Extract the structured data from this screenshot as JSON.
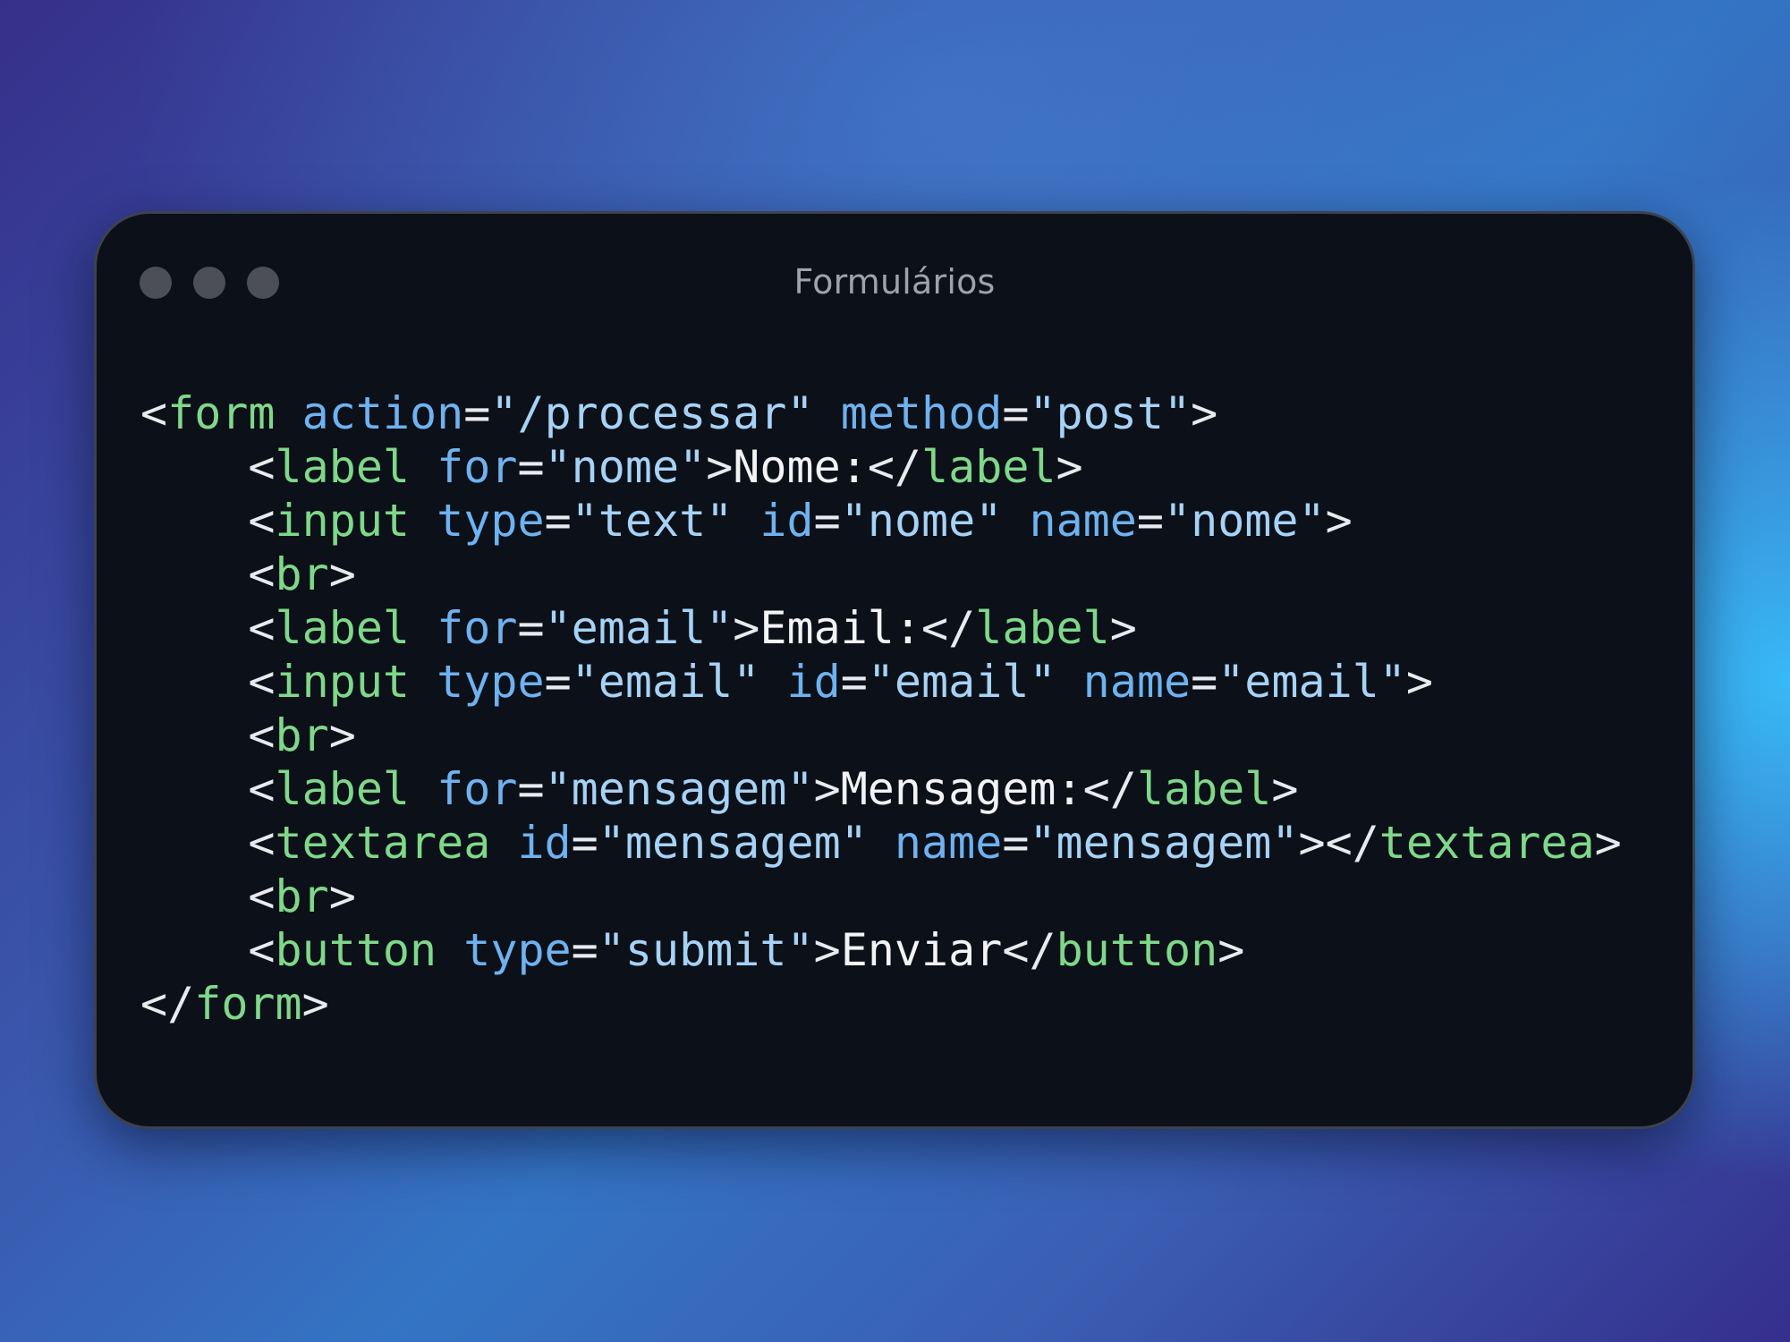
{
  "window": {
    "title": "Formulários",
    "controls": [
      "close",
      "minimize",
      "zoom"
    ]
  },
  "colors": {
    "background_start": "#36308a",
    "background_glow": "#38bef9",
    "window_bg": "#0c1018",
    "tag": "#7fd88a",
    "attribute": "#6eb2f0",
    "string": "#a6d2f5",
    "text": "#f2f3f5",
    "title": "#9da3ad",
    "control_dot": "#4c4f57"
  },
  "code": {
    "language": "html",
    "lines": [
      [
        [
          "punc",
          "<"
        ],
        [
          "tag",
          "form"
        ],
        [
          "punc",
          " "
        ],
        [
          "attr",
          "action"
        ],
        [
          "punc",
          "="
        ],
        [
          "str",
          "\"/processar\""
        ],
        [
          "punc",
          " "
        ],
        [
          "attr",
          "method"
        ],
        [
          "punc",
          "="
        ],
        [
          "str",
          "\"post\""
        ],
        [
          "punc",
          ">"
        ]
      ],
      [
        [
          "punc",
          "    <"
        ],
        [
          "tag",
          "label"
        ],
        [
          "punc",
          " "
        ],
        [
          "attr",
          "for"
        ],
        [
          "punc",
          "="
        ],
        [
          "str",
          "\"nome\""
        ],
        [
          "punc",
          ">"
        ],
        [
          "txt",
          "Nome:"
        ],
        [
          "punc",
          "</"
        ],
        [
          "tag",
          "label"
        ],
        [
          "punc",
          ">"
        ]
      ],
      [
        [
          "punc",
          "    <"
        ],
        [
          "tag",
          "input"
        ],
        [
          "punc",
          " "
        ],
        [
          "attr",
          "type"
        ],
        [
          "punc",
          "="
        ],
        [
          "str",
          "\"text\""
        ],
        [
          "punc",
          " "
        ],
        [
          "attr",
          "id"
        ],
        [
          "punc",
          "="
        ],
        [
          "str",
          "\"nome\""
        ],
        [
          "punc",
          " "
        ],
        [
          "attr",
          "name"
        ],
        [
          "punc",
          "="
        ],
        [
          "str",
          "\"nome\""
        ],
        [
          "punc",
          ">"
        ]
      ],
      [
        [
          "punc",
          "    <"
        ],
        [
          "tag",
          "br"
        ],
        [
          "punc",
          ">"
        ]
      ],
      [
        [
          "punc",
          "    <"
        ],
        [
          "tag",
          "label"
        ],
        [
          "punc",
          " "
        ],
        [
          "attr",
          "for"
        ],
        [
          "punc",
          "="
        ],
        [
          "str",
          "\"email\""
        ],
        [
          "punc",
          ">"
        ],
        [
          "txt",
          "Email:"
        ],
        [
          "punc",
          "</"
        ],
        [
          "tag",
          "label"
        ],
        [
          "punc",
          ">"
        ]
      ],
      [
        [
          "punc",
          "    <"
        ],
        [
          "tag",
          "input"
        ],
        [
          "punc",
          " "
        ],
        [
          "attr",
          "type"
        ],
        [
          "punc",
          "="
        ],
        [
          "str",
          "\"email\""
        ],
        [
          "punc",
          " "
        ],
        [
          "attr",
          "id"
        ],
        [
          "punc",
          "="
        ],
        [
          "str",
          "\"email\""
        ],
        [
          "punc",
          " "
        ],
        [
          "attr",
          "name"
        ],
        [
          "punc",
          "="
        ],
        [
          "str",
          "\"email\""
        ],
        [
          "punc",
          ">"
        ]
      ],
      [
        [
          "punc",
          "    <"
        ],
        [
          "tag",
          "br"
        ],
        [
          "punc",
          ">"
        ]
      ],
      [
        [
          "punc",
          "    <"
        ],
        [
          "tag",
          "label"
        ],
        [
          "punc",
          " "
        ],
        [
          "attr",
          "for"
        ],
        [
          "punc",
          "="
        ],
        [
          "str",
          "\"mensagem\""
        ],
        [
          "punc",
          ">"
        ],
        [
          "txt",
          "Mensagem:"
        ],
        [
          "punc",
          "</"
        ],
        [
          "tag",
          "label"
        ],
        [
          "punc",
          ">"
        ]
      ],
      [
        [
          "punc",
          "    <"
        ],
        [
          "tag",
          "textarea"
        ],
        [
          "punc",
          " "
        ],
        [
          "attr",
          "id"
        ],
        [
          "punc",
          "="
        ],
        [
          "str",
          "\"mensagem\""
        ],
        [
          "punc",
          " "
        ],
        [
          "attr",
          "name"
        ],
        [
          "punc",
          "="
        ],
        [
          "str",
          "\"mensagem\""
        ],
        [
          "punc",
          "></"
        ],
        [
          "tag",
          "textarea"
        ],
        [
          "punc",
          ">"
        ]
      ],
      [
        [
          "punc",
          "    <"
        ],
        [
          "tag",
          "br"
        ],
        [
          "punc",
          ">"
        ]
      ],
      [
        [
          "punc",
          "    <"
        ],
        [
          "tag",
          "button"
        ],
        [
          "punc",
          " "
        ],
        [
          "attr",
          "type"
        ],
        [
          "punc",
          "="
        ],
        [
          "str",
          "\"submit\""
        ],
        [
          "punc",
          ">"
        ],
        [
          "txt",
          "Enviar"
        ],
        [
          "punc",
          "</"
        ],
        [
          "tag",
          "button"
        ],
        [
          "punc",
          ">"
        ]
      ],
      [
        [
          "punc",
          "</"
        ],
        [
          "tag",
          "form"
        ],
        [
          "punc",
          ">"
        ]
      ]
    ]
  }
}
